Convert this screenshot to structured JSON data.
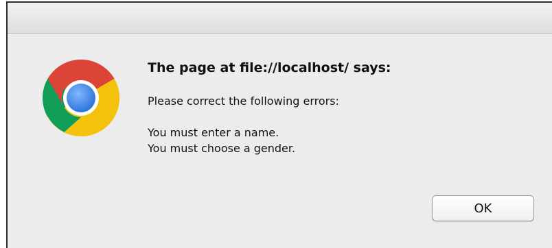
{
  "dialog": {
    "title": "The page at file://localhost/ says:",
    "message_lines": [
      "Please correct the following errors:",
      "",
      "You must enter a name.",
      "You must choose a gender."
    ],
    "ok_label": "OK"
  },
  "icon": {
    "name": "chrome-icon",
    "colors": {
      "red": "#db4437",
      "green": "#0f9d58",
      "yellow": "#f4c20d",
      "blue": "#4285f4"
    }
  }
}
